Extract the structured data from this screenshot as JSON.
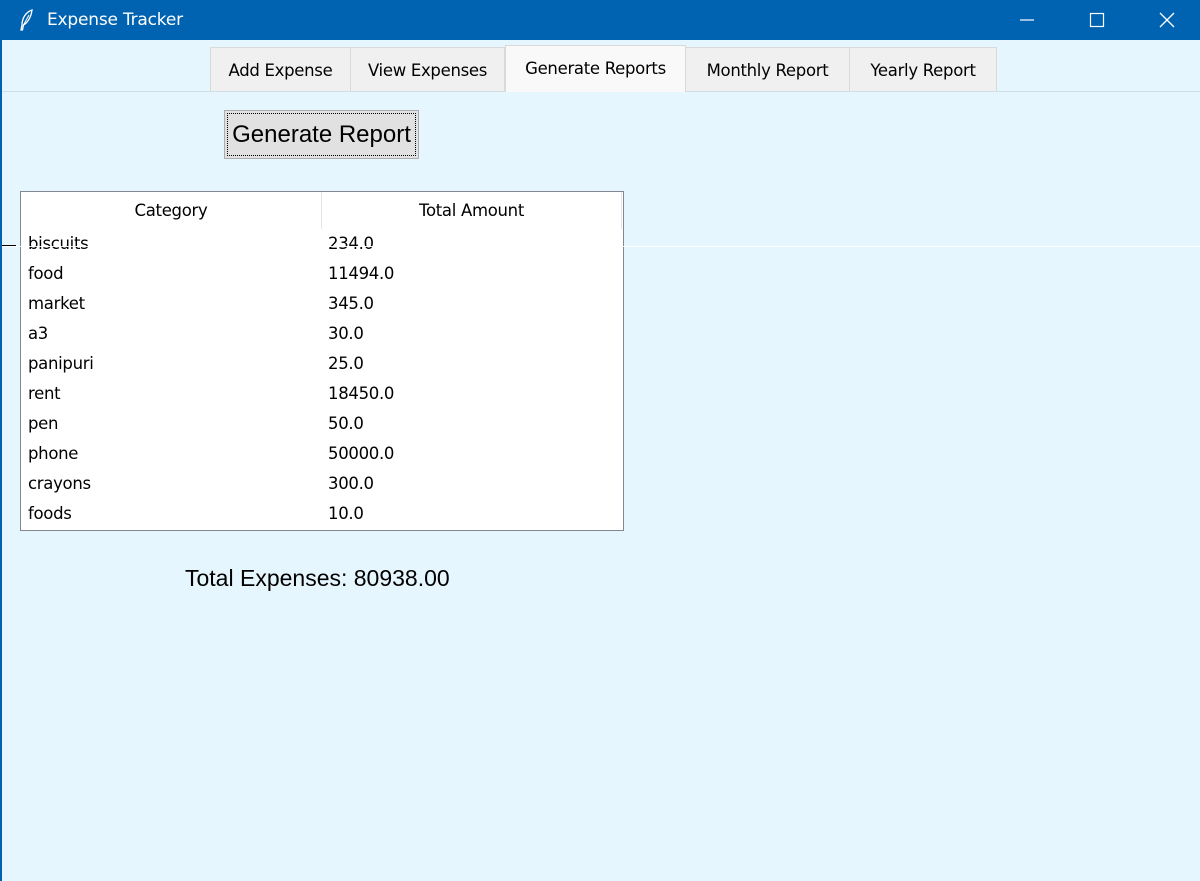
{
  "window": {
    "title": "Expense Tracker"
  },
  "tabs": [
    {
      "label": "Add Expense"
    },
    {
      "label": "View Expenses"
    },
    {
      "label": "Generate Reports",
      "active": true
    },
    {
      "label": "Monthly Report"
    },
    {
      "label": "Yearly Report"
    }
  ],
  "report": {
    "generate_label": "Generate Report",
    "columns": [
      "Category",
      "Total Amount"
    ],
    "rows": [
      {
        "category": "biscuits",
        "amount": "234.0"
      },
      {
        "category": "food",
        "amount": "11494.0"
      },
      {
        "category": "market",
        "amount": "345.0"
      },
      {
        "category": "a3",
        "amount": "30.0"
      },
      {
        "category": "panipuri",
        "amount": "25.0"
      },
      {
        "category": "rent",
        "amount": "18450.0"
      },
      {
        "category": "pen",
        "amount": "50.0"
      },
      {
        "category": "phone",
        "amount": "50000.0"
      },
      {
        "category": "crayons",
        "amount": "300.0"
      },
      {
        "category": "foods",
        "amount": "10.0"
      }
    ],
    "total_text": "Total Expenses: 80938.00"
  },
  "colors": {
    "titlebar": "#0063b1",
    "background": "#e6f6fe",
    "tab_active": "#f9f9f9",
    "tab_inactive": "#f0f0f0"
  },
  "icons": {
    "app": "feather-icon",
    "minimize": "minimize-icon",
    "maximize": "maximize-icon",
    "close": "close-icon"
  }
}
